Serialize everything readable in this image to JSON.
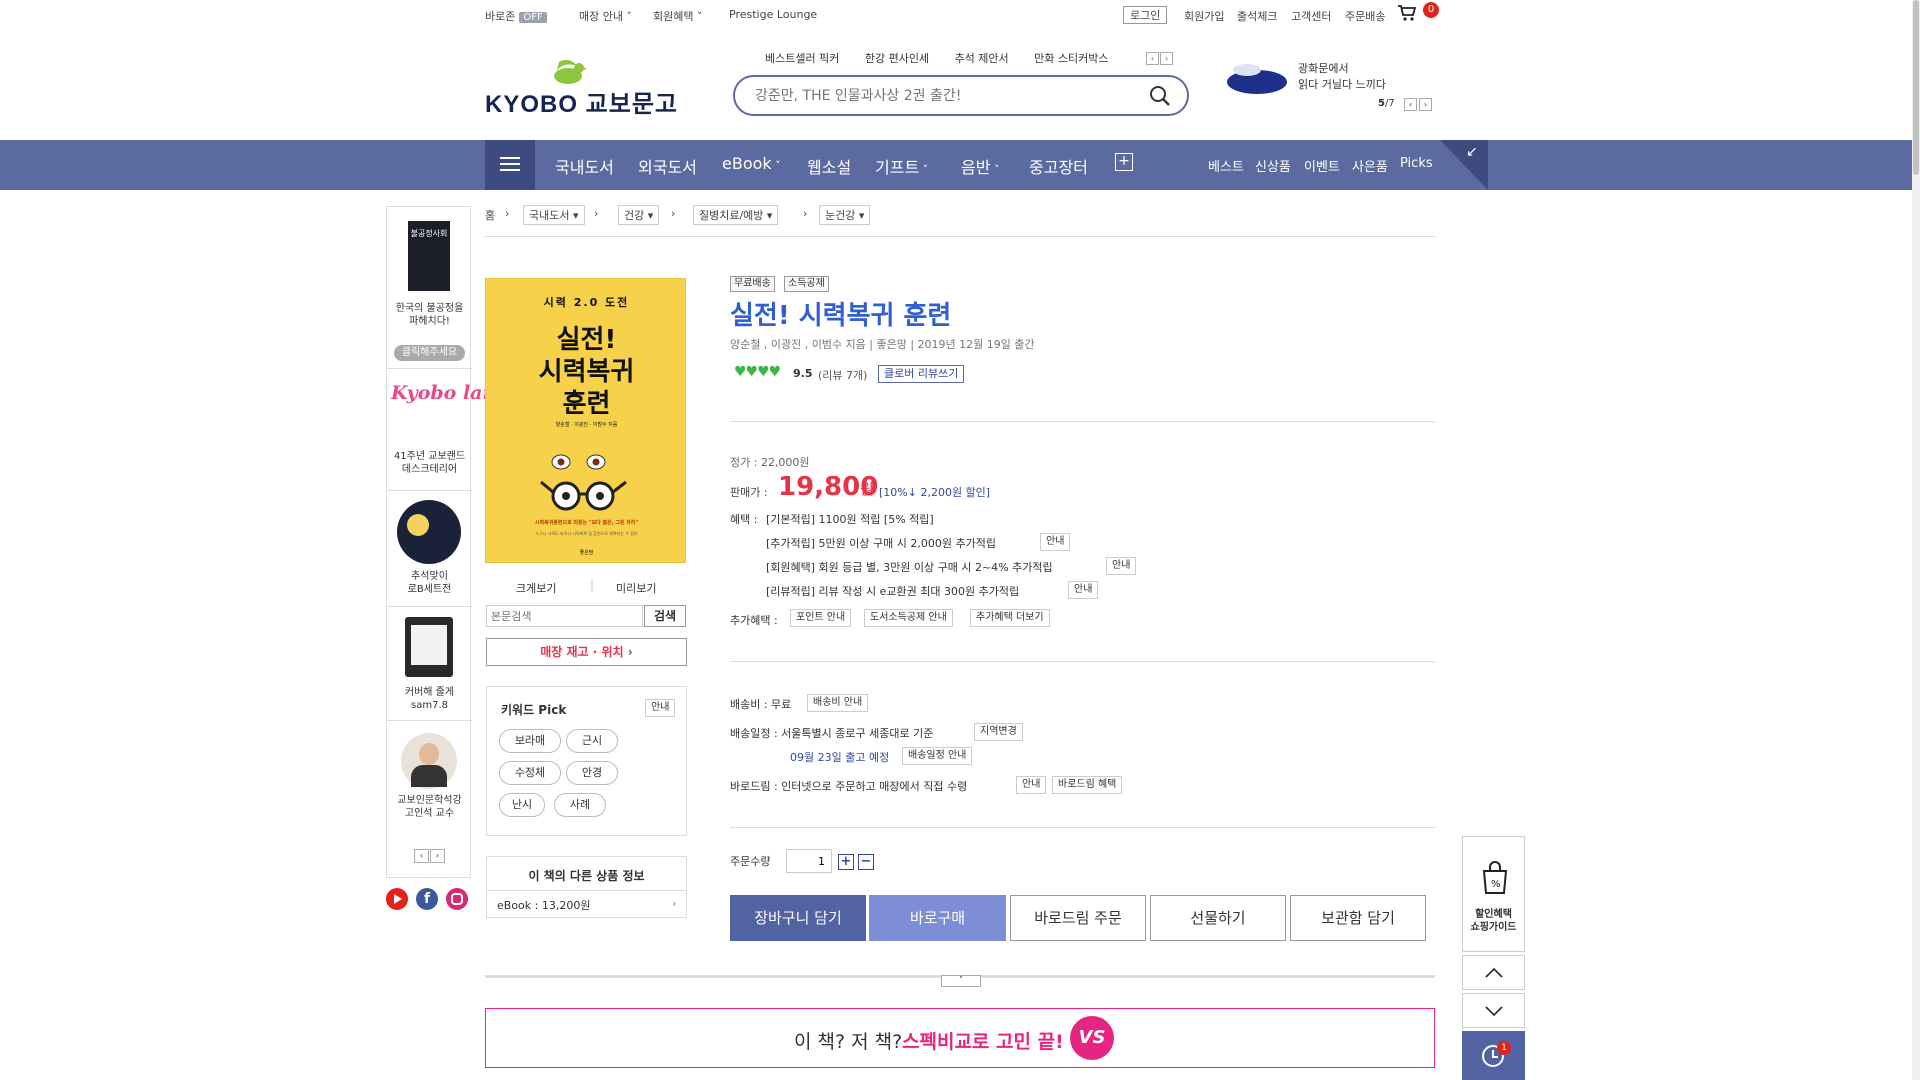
{
  "topbar": {
    "baro": "바로존",
    "baro_badge": "OFF",
    "store_info": "매장 안내",
    "member_benefit": "회원혜택",
    "prestige": "Prestige Lounge",
    "login": "로그인",
    "join": "회원가입",
    "attendance": "출석체크",
    "customer_center": "고객센터",
    "order_delivery": "주문배송",
    "cart_count": "0"
  },
  "header": {
    "logo_text": "KYOBO 교보문고",
    "hotwords": [
      "베스트셀러 픽커",
      "한강 편사인세",
      "추석 제안서",
      "만화 스티커박스"
    ],
    "search_placeholder": "강준만, THE 인물과사상 2권 출간!",
    "promo_line1": "광화문에서",
    "promo_line2": "읽다 거닐다 느끼다",
    "promo_logo": "광화문에서 읽다 거닐다 느끼다",
    "promo_page_current": "5",
    "promo_page_total": "/7"
  },
  "nav": {
    "categories": [
      "국내도서",
      "외국도서",
      "eBook",
      "웹소설",
      "기프트",
      "음반",
      "중고장터"
    ],
    "sub": [
      "베스트",
      "신상품",
      "이벤트",
      "사은품",
      "Picks"
    ]
  },
  "breadcrumb": {
    "home": "홈",
    "items": [
      "국내도서",
      "건강",
      "질병치료/예방",
      "눈건강"
    ]
  },
  "left_ads": [
    {
      "title": "불공정사회",
      "line1": "한국의 불공정을",
      "line2": "파헤치다!",
      "button": "클릭해주세요"
    },
    {
      "title": "Kyobo land",
      "line1": "41주년 교보랜드",
      "line2": "데스크테리어"
    },
    {
      "line1": "추석맞이",
      "line2": "로B세트전"
    },
    {
      "line1": "커버해 줄게",
      "line2": "sam7.8"
    },
    {
      "line1": "교보인문학석강",
      "line2": "고인석 교수"
    }
  ],
  "book": {
    "cover_top": "시력 2.0 도전",
    "cover_title1": "실전!",
    "cover_title2": "시력복귀",
    "cover_title3": "훈련",
    "cover_authors": "양순철 · 이광진 · 이범수 지음",
    "cover_sub": "시력복귀훈련으로 되찾는 \"보다 젊은, 그린 자리\"",
    "cover_sub2": "누구나 시력도 바꾸고 시력회복 및 훈련으로 회복하는 수 있다",
    "cover_publisher": "좋은땅",
    "zoom": "크게보기",
    "preview": "미리보기",
    "body_search_placeholder": "본문검색",
    "search_btn": "검색",
    "store_stock": "매장 재고 · 위치"
  },
  "keyword_pick": {
    "title": "키워드 Pick",
    "guide": "안내",
    "keywords": [
      "보라매",
      "근시",
      "수정체",
      "안경",
      "난시",
      "사례"
    ]
  },
  "other_info": {
    "title": "이 책의 다른 상품 정보",
    "ebook": "eBook : 13,200원"
  },
  "detail": {
    "badges": [
      "무료배송",
      "소득공제"
    ],
    "title": "실전! 시력복귀 훈련",
    "author_line": "양순철 , 이광진 , 이범수 지음 | 좋은땅 | 2019년 12월 19일 출간",
    "rating": "9.5",
    "review_count": "(리뷰 7개)",
    "review_btn": "클로버 리뷰쓰기",
    "list_price": "정가 : 22,000원",
    "sale_label": "판매가 :",
    "sale_price": "19,800",
    "won": "원",
    "discount": "[10%↓ 2,200원 할인]",
    "benefit_label": "혜택 :",
    "benefit_main": "[기본적립] 1100원 적립 [5% 적립]",
    "benefit_1": "[추가적립] 5만원 이상 구매 시 2,000원 추가적립",
    "benefit_2": "[회원혜택] 회원 등급 별, 3만원 이상 구매 시 2~4% 추가적립",
    "benefit_3": "[리뷰적립] 리뷰 작성 시 e교환권 최대 300원 추가적립",
    "guide": "안내",
    "extra_label": "추가혜택 :",
    "extra_btns": [
      "포인트 안내",
      "도서소득공제 안내",
      "추가혜택 더보기"
    ],
    "ship_fee": "배송비 : 무료",
    "ship_fee_btn": "배송비 안내",
    "ship_date": "배송일정 : 서울특별시 종로구 세종대로 기준",
    "region_btn": "지역변경",
    "ship_eta": "09월 23일 출고 예정",
    "ship_eta_btn": "배송일정 안내",
    "barodrim": "바로드림 : 인터넷으로 주문하고 매장에서 직접 수령",
    "barodrim_btn": "바로드림 혜택",
    "qty_label": "주문수량",
    "qty": "1",
    "buttons": [
      "장바구니 담기",
      "바로구매",
      "바로드림 주문",
      "선물하기",
      "보관함 담기"
    ]
  },
  "compare_banner": {
    "text1": "이 책? 저 책? ",
    "text2": "스펙비교로 고민 끝!",
    "badge": "VS"
  },
  "right_float": {
    "guide1": "할인혜택",
    "guide2": "쇼핑가이드",
    "recent_count": "1"
  },
  "colors": {
    "nav": "#5b6ba0",
    "accent_blue": "#2f5fd0",
    "price_red": "#e53347",
    "magenta": "#e62583"
  }
}
